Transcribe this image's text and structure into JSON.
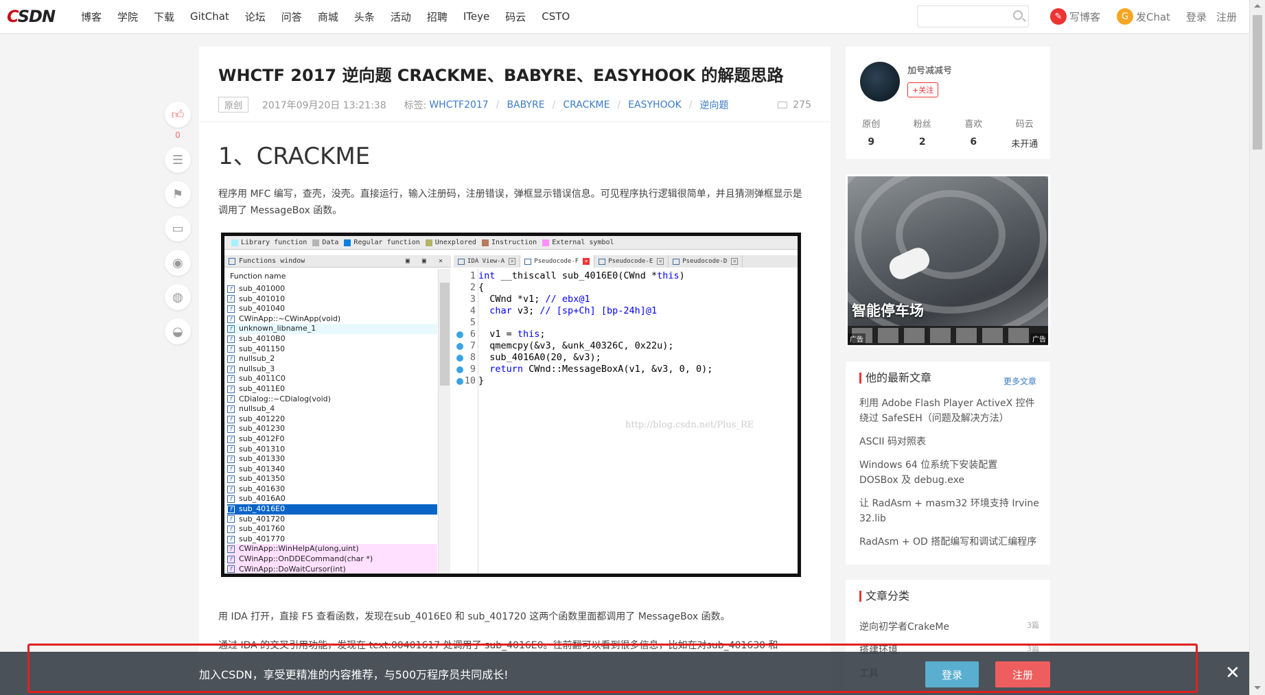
{
  "header": {
    "logo": {
      "c": "C",
      "rest": "SDN"
    },
    "nav": [
      "博客",
      "学院",
      "下载",
      "GitChat",
      "论坛",
      "问答",
      "商城",
      "头条",
      "活动",
      "招聘",
      "ITeye",
      "码云",
      "CSTO"
    ],
    "write_blog": "写博客",
    "write_blog_icon": "✎",
    "fachat": "发Chat",
    "fachat_icon": "G",
    "login": "登录",
    "register": "注册"
  },
  "tools": {
    "like_count": "0"
  },
  "article": {
    "title": "WHCTF 2017 逆向题 CRACKME、BABYRE、EASYHOOK 的解题思路",
    "original_badge": "原创",
    "date": "2017年09月20日 13:21:38",
    "tags_label": "标签:",
    "tags": [
      "WHCTF2017",
      "BABYRE",
      "CRACKME",
      "EASYHOOK",
      "逆向题"
    ],
    "views": "275",
    "h1": "1、CRACKME",
    "para1": "程序用 MFC 编写，查壳，没壳。直接运行，输入注册码，注册错误，弹框显示错误信息。可见程序执行逻辑很简单，并且猜测弹框显示是调用了 MessageBox 函数。",
    "para2": "用 IDA 打开，直接 F5 查看函数，发现在sub_4016E0 和 sub_401720 这两个函数里面都调用了 MessageBox 函数。",
    "para3": "通过 IDA 的交叉引用功能，发现在 text:00401617 处调用了 sub_4016E0。往前翻可以看到很多信息，比如在对sub_401630 和"
  },
  "ida": {
    "legend": [
      {
        "label": "Library function",
        "color": "#a6f0ff"
      },
      {
        "label": "Data",
        "color": "#b4b4b4"
      },
      {
        "label": "Regular function",
        "color": "#0a7ee0"
      },
      {
        "label": "Unexplored",
        "color": "#b5b56a"
      },
      {
        "label": "Instruction",
        "color": "#b87a5e"
      },
      {
        "label": "External symbol",
        "color": "#ff90ff"
      }
    ],
    "functions_window": "Functions window",
    "functions_ctrls": "▣ ▣ ✕",
    "column": "Function name",
    "functions": [
      {
        "name": "sub_401000"
      },
      {
        "name": "sub_401010"
      },
      {
        "name": "sub_401040"
      },
      {
        "name": "CWinApp::~CWinApp(void)"
      },
      {
        "name": "unknown_libname_1"
      },
      {
        "name": "sub_4010B0"
      },
      {
        "name": "sub_401150"
      },
      {
        "name": "nullsub_2"
      },
      {
        "name": "nullsub_3"
      },
      {
        "name": "sub_4011C0"
      },
      {
        "name": "sub_4011E0"
      },
      {
        "name": "CDialog::~CDialog(void)"
      },
      {
        "name": "nullsub_4"
      },
      {
        "name": "sub_401220"
      },
      {
        "name": "sub_401230"
      },
      {
        "name": "sub_4012F0"
      },
      {
        "name": "sub_401310"
      },
      {
        "name": "sub_401330"
      },
      {
        "name": "sub_401340"
      },
      {
        "name": "sub_401350"
      },
      {
        "name": "sub_401630"
      },
      {
        "name": "sub_4016A0"
      },
      {
        "name": "sub_4016E0"
      },
      {
        "name": "sub_401720"
      },
      {
        "name": "sub_401760"
      },
      {
        "name": "sub_401770"
      },
      {
        "name": "CWinApp::WinHelpA(ulong,uint)"
      },
      {
        "name": "CWinApp::OnDDECommand(char *)"
      },
      {
        "name": "CWinApp::DoWaitCursor(int)"
      }
    ],
    "selected_function": "sub_4016E0",
    "tabs": [
      "IDA View-A",
      "Pseudocode-F",
      "Pseudocode-E",
      "Pseudocode-D"
    ],
    "active_tab": "Pseudocode-F",
    "code": [
      {
        "n": "1",
        "t": "int __thiscall sub_4016E0(CWnd *this)"
      },
      {
        "n": "2",
        "t": "{"
      },
      {
        "n": "3",
        "t": "  CWnd *v1; // ebx@1"
      },
      {
        "n": "4",
        "t": "  char v3; // [sp+Ch] [bp-24h]@1"
      },
      {
        "n": "5",
        "t": ""
      },
      {
        "n": "6",
        "t": "  v1 = this;"
      },
      {
        "n": "7",
        "t": "  qmemcpy(&v3, &unk_40326C, 0x22u);"
      },
      {
        "n": "8",
        "t": "  sub_4016A0(20, &v3);"
      },
      {
        "n": "9",
        "t": "  return CWnd::MessageBoxA(v1, &v3, 0, 0);"
      },
      {
        "n": "10",
        "t": "}"
      }
    ],
    "watermark": "http://blog.csdn.net/Plus_RE"
  },
  "sidebar": {
    "profile": {
      "name": "加号减减号",
      "follow": "+关注",
      "stats": [
        {
          "label": "原创",
          "value": "9"
        },
        {
          "label": "粉丝",
          "value": "2"
        },
        {
          "label": "喜欢",
          "value": "6"
        },
        {
          "label": "码云",
          "value": "未开通"
        }
      ]
    },
    "ad": {
      "title": "智能停车场",
      "label": "广告"
    },
    "recent": {
      "title": "他的最新文章",
      "more": "更多文章",
      "items": [
        "利用 Adobe Flash Player ActiveX 控件绕过 SafeSEH（问题及解决方法）",
        "ASCII 码对照表",
        "Windows 64 位系统下安装配置 DOSBox 及 debug.exe",
        "让 RadAsm + masm32 环境支持 Irvine 32.lib",
        "RadAsm + OD 搭配编写和调试汇编程序"
      ]
    },
    "categories": {
      "title": "文章分类",
      "items": [
        {
          "name": "逆向初学者CrakeMe",
          "count": "3篇"
        },
        {
          "name": "搭建环境",
          "count": "3篇"
        },
        {
          "name": "工具",
          "count": ""
        }
      ]
    }
  },
  "banner": {
    "text": "加入CSDN，享受更精准的内容推荐，与500万程序员共同成长!",
    "login": "登录",
    "register": "注册",
    "close": "✕"
  }
}
